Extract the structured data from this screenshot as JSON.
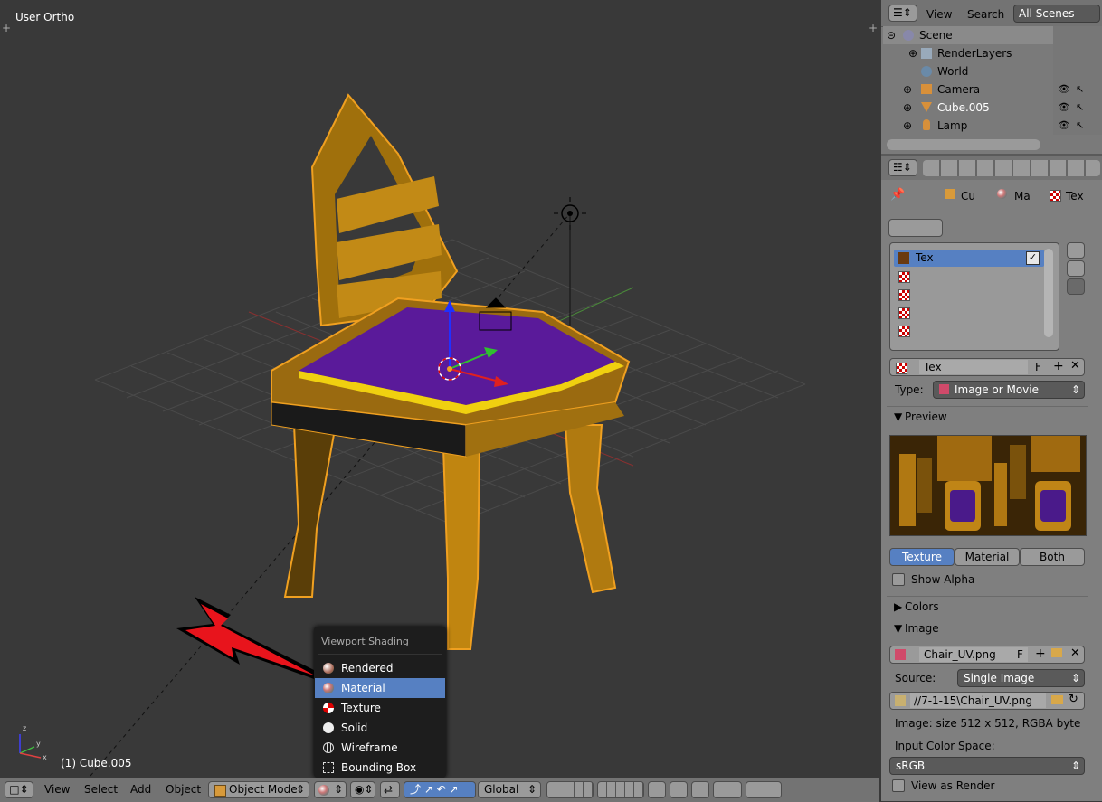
{
  "viewport": {
    "view_label": "User Ortho",
    "object_label": "(1) Cube.005",
    "shading_popup": {
      "title": "Viewport Shading",
      "items": [
        {
          "label": "Rendered",
          "icon": "rendered-icon",
          "selected": false
        },
        {
          "label": "Material",
          "icon": "material-icon",
          "selected": true
        },
        {
          "label": "Texture",
          "icon": "texture-icon",
          "selected": false
        },
        {
          "label": "Solid",
          "icon": "solid-icon",
          "selected": false
        },
        {
          "label": "Wireframe",
          "icon": "wireframe-icon",
          "selected": false
        },
        {
          "label": "Bounding Box",
          "icon": "bounding-box-icon",
          "selected": false
        }
      ]
    }
  },
  "bottom_header": {
    "menus": [
      "View",
      "Select",
      "Add",
      "Object"
    ],
    "mode": "Object Mode",
    "orientation": "Global"
  },
  "outliner": {
    "header": {
      "view": "View",
      "search": "Search",
      "scenes": "All Scenes"
    },
    "rows": [
      {
        "label": "Scene"
      },
      {
        "label": "RenderLayers"
      },
      {
        "label": "World"
      },
      {
        "label": "Camera"
      },
      {
        "label": "Cube.005"
      },
      {
        "label": "Lamp"
      }
    ]
  },
  "properties": {
    "breadcrumb": [
      "Cu",
      "Ma",
      "Tex"
    ],
    "texture_slots": {
      "first": "Tex"
    },
    "texture_name": "Tex",
    "fake_user": "F",
    "type_label": "Type:",
    "type_value": "Image or Movie",
    "preview": {
      "title": "Preview",
      "tabs": [
        "Texture",
        "Material",
        "Both"
      ],
      "active_tab": "Texture",
      "show_alpha": "Show Alpha"
    },
    "colors_panel": "Colors",
    "image_panel": {
      "title": "Image",
      "image_name": "Chair_UV.png",
      "fake_user": "F",
      "source_label": "Source:",
      "source_value": "Single Image",
      "path": "//7-1-15\\Chair_UV.png",
      "info": "Image: size 512 x 512, RGBA byte",
      "color_space_label": "Input Color Space:",
      "color_space_value": "sRGB",
      "view_as_render": "View as Render"
    }
  },
  "colors": {
    "selection": "#5680c2",
    "tab_active": "#5680c2",
    "annotation_arrow": "#e8141c"
  }
}
